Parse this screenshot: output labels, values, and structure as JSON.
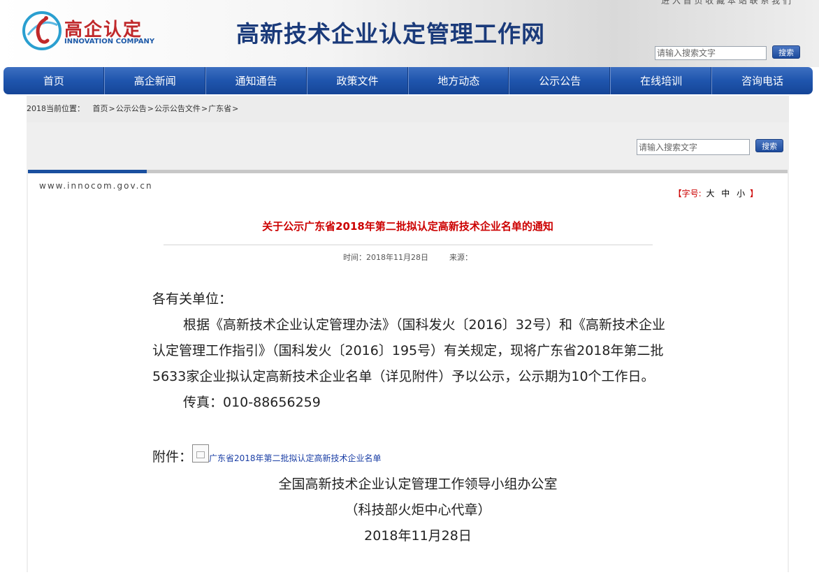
{
  "header": {
    "top_links": "进 入 首 页 收 藏 本 站 联 系 我 们",
    "logo_cn": "高企认定",
    "logo_en": "INNOVATION COMPANY",
    "site_title": "高新技术企业认定管理工作网",
    "search_placeholder": "请输入搜索文字",
    "search_button": "搜索"
  },
  "nav": [
    "首页",
    "高企新闻",
    "通知通告",
    "政策文件",
    "地方动态",
    "公示公告",
    "在线培训",
    "咨询电话"
  ],
  "breadcrumb": {
    "prefix": "2018当前位置：",
    "items": [
      "首页",
      "公示公告",
      "公示公告文件",
      "广东省"
    ],
    "sep": ">"
  },
  "content_search": {
    "placeholder": "请输入搜索文字",
    "button": "搜索"
  },
  "article": {
    "domain": "www.innocom.gov.cn",
    "font_size_label": "【字号:",
    "font_sizes": [
      "大",
      "中",
      "小"
    ],
    "font_size_end": "】",
    "title": "关于公示广东省2018年第二批拟认定高新技术企业名单的通知",
    "time_label": "时间：2018年11月28日",
    "source_label": "来源：",
    "salutation": "各有关单位：",
    "paragraph": "根据《高新技术企业认定管理办法》（国科发火〔2016〕32号）和《高新技术企业认定管理工作指引》（国科发火〔2016〕195号）有关规定，现将广东省2018年第二批5633家企业拟认定高新技术企业名单（详见附件）予以公示，公示期为10个工作日。",
    "fax": "传真：010-88656259",
    "attachment_label": "附件：",
    "attachment_link": "广东省2018年第二批拟认定高新技术企业名单",
    "signature_org": "全国高新技术企业认定管理工作领导小组办公室",
    "signature_proxy": "（科技部火炬中心代章）",
    "signature_date": "2018年11月28日"
  },
  "colors": {
    "nav": "#1f55ad",
    "title_red": "#cc0000",
    "brand_red": "#c0282a",
    "link_blue": "#1a3ea5"
  }
}
